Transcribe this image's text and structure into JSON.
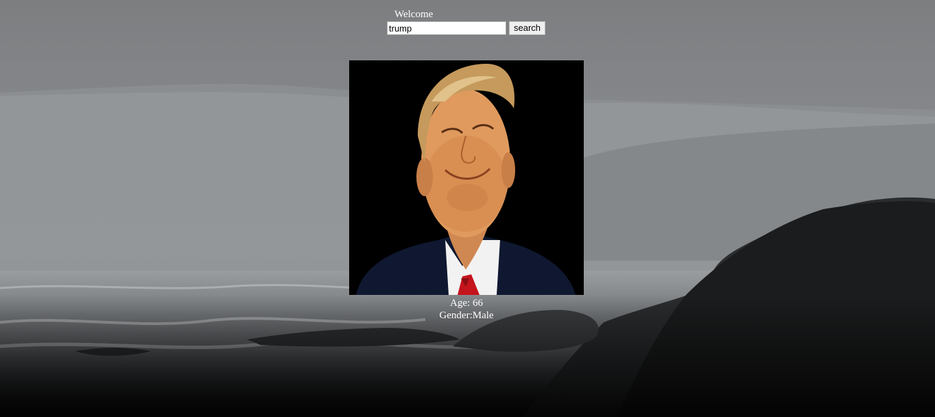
{
  "header": {
    "welcome_text": "Welcome"
  },
  "search": {
    "value": "trump",
    "button_label": "search"
  },
  "result": {
    "age_text": "Age: 66",
    "gender_text": "Gender:Male"
  },
  "icons": {
    "photo": "portrait-photo"
  },
  "colors": {
    "text": "#ffffff",
    "photo_background": "#000000",
    "tie": "#c4141c",
    "suit": "#0f1830"
  }
}
